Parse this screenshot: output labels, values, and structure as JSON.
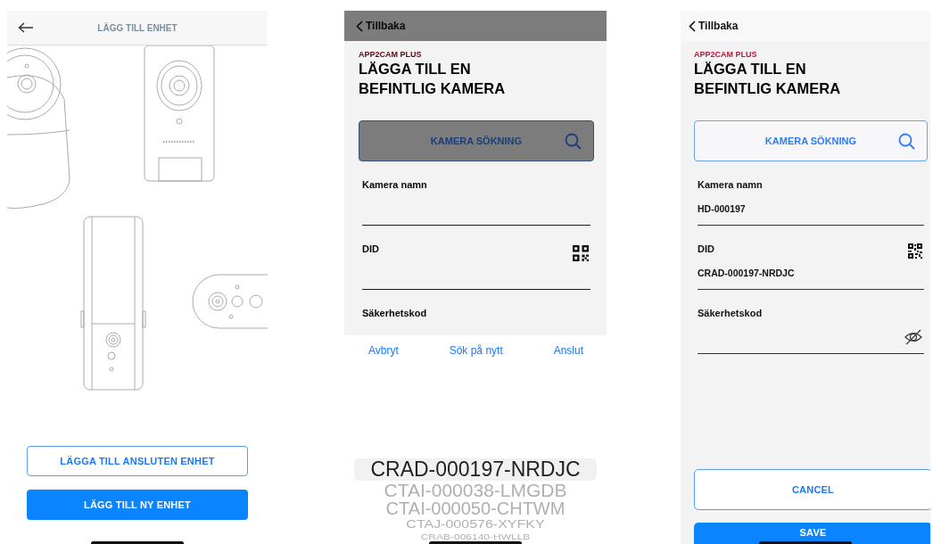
{
  "screens": [
    {
      "kind": "device_chooser",
      "header": {
        "title": "LÄGG TILL ENHET"
      },
      "buttons": [
        {
          "label": "LÄGGA TILL ANSLUTEN ENHET",
          "kind": "outline"
        },
        {
          "label": "LÄGG TILL NY ENHET",
          "kind": "filled"
        }
      ]
    },
    {
      "kind": "camera_form",
      "dimmed": true,
      "back": "Tillbaka",
      "brand": "APP2CAM PLUS",
      "title_lines": [
        "LÄGGA TILL EN",
        "BEFINTLIG KAMERA"
      ],
      "search_button": "KAMERA SÖKNING",
      "fields": [
        {
          "kind": "text",
          "label": "Kamera namn"
        },
        {
          "kind": "qr",
          "label": "DID"
        },
        {
          "kind": "label_only",
          "label": "Säkerhetskod"
        }
      ],
      "sheet": {
        "actions": [
          "Avbryt",
          "Sök på nytt",
          "Anslut"
        ],
        "options": [
          {
            "label": "CRAD-000197-NRDJC",
            "selected": true
          },
          {
            "label": "CTAI-000038-LMGDB",
            "selected": false
          },
          {
            "label": "CTAI-000050-CHTWM",
            "selected": false
          },
          {
            "label": "CTAJ-000576-XYFKY",
            "selected": false
          },
          {
            "label": "CRAB-006140-HWLLB",
            "selected": false
          }
        ]
      }
    },
    {
      "kind": "camera_form",
      "dimmed": false,
      "back": "Tillbaka",
      "brand": "APP2CAM PLUS",
      "title_lines": [
        "LÄGGA TILL EN",
        "BEFINTLIG KAMERA"
      ],
      "search_button": "KAMERA SÖKNING",
      "fields": [
        {
          "kind": "text",
          "label": "Kamera namn",
          "value": "HD-000197"
        },
        {
          "kind": "qr",
          "label": "DID",
          "value": "CRAD-000197-NRDJC"
        },
        {
          "kind": "secret",
          "label": "Säkerhetskod"
        }
      ],
      "buttons": [
        {
          "label": "CANCEL",
          "kind": "outline"
        },
        {
          "label": "SAVE",
          "kind": "filled"
        }
      ]
    }
  ]
}
